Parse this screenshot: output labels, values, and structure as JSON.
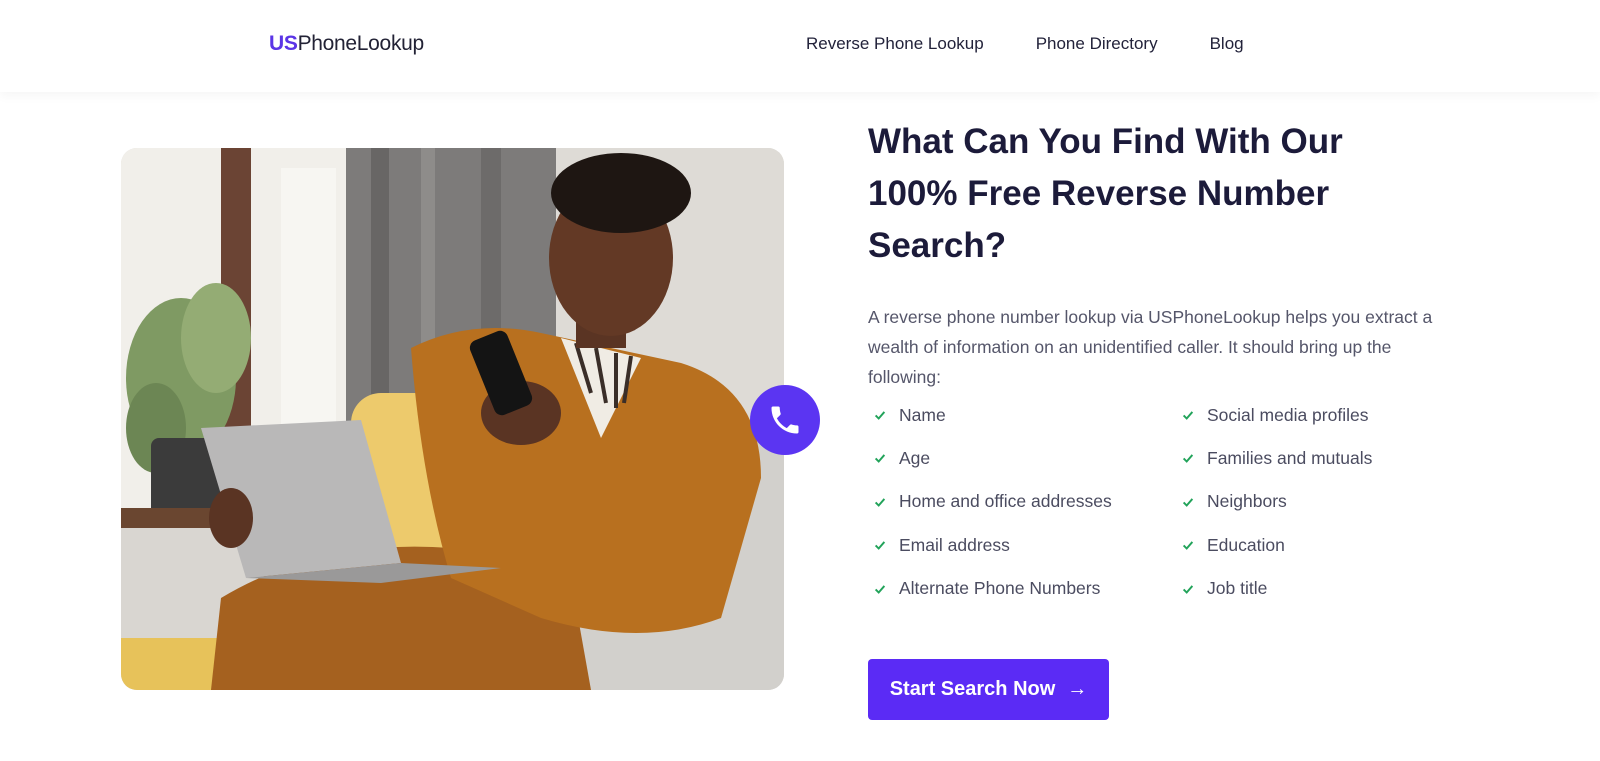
{
  "header": {
    "logo_us": "US",
    "logo_rest": "PhoneLookup",
    "nav": [
      "Reverse Phone Lookup",
      "Phone Directory",
      "Blog"
    ]
  },
  "hero_image": {
    "icon": "phone-icon",
    "accent": "#5b35f2"
  },
  "content": {
    "title": "What Can You Find With Our 100% Free Reverse Number Search?",
    "description": "A reverse phone number lookup via USPhoneLookup helps you extract a wealth of information on an unidentified caller. It should bring up the following:",
    "features_left": [
      "Name",
      "Age",
      "Home and office addresses",
      "Email address",
      "Alternate Phone Numbers"
    ],
    "features_right": [
      "Social media profiles",
      "Families and mutuals",
      "Neighbors",
      "Education",
      "Job title"
    ],
    "check_color": "#22a35a",
    "cta_label": "Start Search Now",
    "cta_arrow": "→"
  }
}
